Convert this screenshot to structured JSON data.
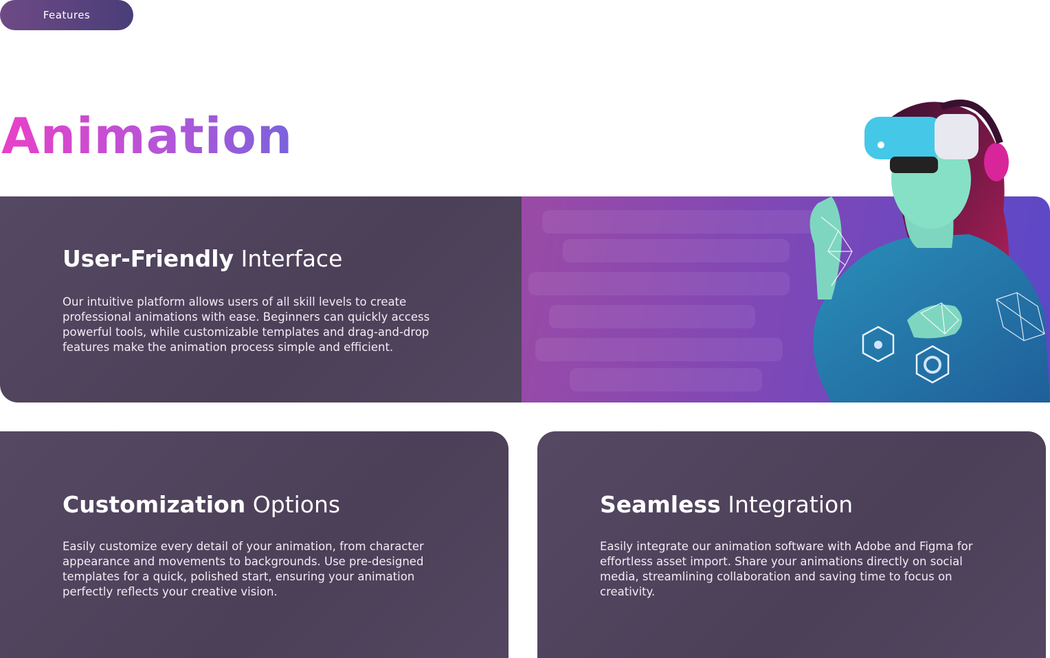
{
  "badge": {
    "label": "Features"
  },
  "hero": {
    "title": "Animation"
  },
  "cards": [
    {
      "title_bold": "User-Friendly",
      "title_light": "Interface",
      "body": "Our intuitive platform allows users of all skill levels to create professional animations with ease. Beginners can quickly access powerful tools, while customizable templates and drag-and-drop features make the animation process simple and efficient."
    },
    {
      "title_bold": "Customization",
      "title_light": "Options",
      "body": "Easily customize every detail of your animation, from character appearance and movements to backgrounds. Use pre-designed templates for a quick, polished start, ensuring your animation perfectly reflects your creative vision."
    },
    {
      "title_bold": "Seamless",
      "title_light": "Integration",
      "body": "Easily integrate our animation software with Adobe and Figma for effortless asset import. Share your animations directly on social media, streamlining collaboration and saving time to focus on creativity."
    }
  ],
  "colors": {
    "title_gradient_start": "#e840c8",
    "title_gradient_end": "#7a63dc",
    "card_bg": "#4f435c",
    "badge_bg": "#5a4380"
  },
  "icons": [
    "vr-headset-illustration"
  ]
}
